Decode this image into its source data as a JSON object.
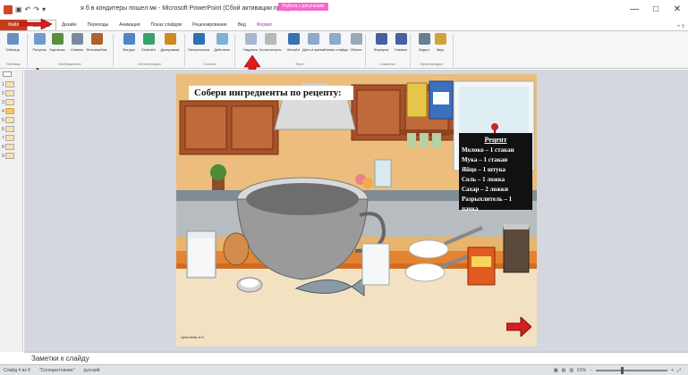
{
  "window": {
    "title": "я б в кондитеры пошел мк  - Microsoft PowerPoint (Сбой активации продукта)",
    "context_tools": "Работа с рисунками",
    "controls": [
      "—",
      "□",
      "✕"
    ]
  },
  "tabs": [
    {
      "label": "Файл",
      "kind": "file"
    },
    {
      "label": "Вставка",
      "kind": "active"
    },
    {
      "label": "Дизайн",
      "kind": "normal"
    },
    {
      "label": "Переходы",
      "kind": "normal"
    },
    {
      "label": "Анимация",
      "kind": "normal"
    },
    {
      "label": "Показ слайдов",
      "kind": "normal"
    },
    {
      "label": "Рецензирование",
      "kind": "normal"
    },
    {
      "label": "Вид",
      "kind": "normal"
    },
    {
      "label": "Формат",
      "kind": "context"
    }
  ],
  "ribbon": {
    "buttons": [
      {
        "label": "Таблица",
        "color": "#6a8fc4"
      },
      {
        "label": "Рисунок",
        "color": "#6f9bd1"
      },
      {
        "label": "Картинка",
        "color": "#5b8e3d"
      },
      {
        "label": "Снимок",
        "color": "#7a8aa0"
      },
      {
        "label": "Фотоальбом",
        "color": "#b0602d"
      },
      {
        "label": "Фигуры",
        "color": "#4f86c6"
      },
      {
        "label": "SmartArt",
        "color": "#3aa16b"
      },
      {
        "label": "Диаграмма",
        "color": "#d08a21"
      },
      {
        "label": "Гиперссылка",
        "color": "#2f6fb3"
      },
      {
        "label": "Действие",
        "color": "#7db2d8"
      },
      {
        "label": "Надпись",
        "color": "#a8b8cc"
      },
      {
        "label": "Колонтитулы",
        "color": "#b8b8b8"
      },
      {
        "label": "WordArt",
        "color": "#3b6fb6"
      },
      {
        "label": "Дата и время",
        "color": "#8fa9c8"
      },
      {
        "label": "Номер слайда",
        "color": "#8fa9c8"
      },
      {
        "label": "Объект",
        "color": "#9aa9b8"
      },
      {
        "label": "Формула",
        "color": "#4a5fa1"
      },
      {
        "label": "Символ",
        "color": "#4a5fa1"
      },
      {
        "label": "Видео",
        "color": "#6a7d92"
      },
      {
        "label": "Звук",
        "color": "#d0a33d"
      }
    ],
    "groups": [
      "Таблицы",
      "Изображения",
      "Иллюстрации",
      "Ссылки",
      "Текст",
      "Символы",
      "Мультимедиа"
    ]
  },
  "thumbnails": [
    {
      "num": "1",
      "selected": false
    },
    {
      "num": "2",
      "selected": false
    },
    {
      "num": "3",
      "selected": false
    },
    {
      "num": "4",
      "selected": true
    },
    {
      "num": "5",
      "selected": false
    },
    {
      "num": "6",
      "selected": false
    },
    {
      "num": "7",
      "selected": false
    },
    {
      "num": "8",
      "selected": false
    },
    {
      "num": "9",
      "selected": false
    }
  ],
  "slide": {
    "title": "Собери ингредиенты по рецепту:",
    "recipe_title": "Рецепт",
    "recipe_lines": [
      "Молоко – 1 стакан",
      "Мука – 1 стакан",
      "Яйцо – 1 штука",
      "Соль – 1 ложка",
      "Сахар – 2 ложки",
      "Разрыхлитель – 1",
      "пачка"
    ],
    "author": "Цепелева А.Е."
  },
  "notes": {
    "placeholder": "Заметки к слайду"
  },
  "status": {
    "slide": "Слайд 4 из 9",
    "theme": "\"Солнцестояние\"",
    "language": "русский",
    "zoom": "61%"
  }
}
